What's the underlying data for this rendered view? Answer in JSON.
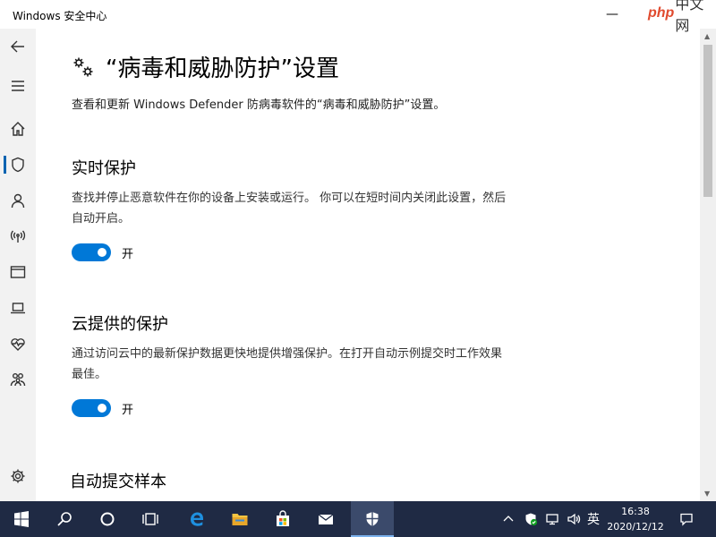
{
  "window": {
    "title": "Windows 安全中心",
    "minimize_glyph": "—",
    "maximize_glyph": "☐"
  },
  "watermark": {
    "php": "php",
    "cn": "中文网"
  },
  "sidebar": {
    "items": [
      {
        "name": "back",
        "icon": "back-arrow-icon"
      },
      {
        "name": "menu",
        "icon": "hamburger-icon"
      },
      {
        "name": "home",
        "icon": "home-icon"
      },
      {
        "name": "virus-protection",
        "icon": "shield-icon",
        "active": true
      },
      {
        "name": "account",
        "icon": "person-icon"
      },
      {
        "name": "firewall",
        "icon": "wireless-icon"
      },
      {
        "name": "app-browser",
        "icon": "browser-window-icon"
      },
      {
        "name": "device-security",
        "icon": "laptop-icon"
      },
      {
        "name": "device-health",
        "icon": "heart-pulse-icon"
      },
      {
        "name": "family",
        "icon": "family-icon"
      },
      {
        "name": "settings",
        "icon": "gear-icon"
      }
    ]
  },
  "page": {
    "title": "“病毒和威胁防护”设置",
    "description": "查看和更新 Windows Defender 防病毒软件的“病毒和威胁防护”设置。"
  },
  "sections": [
    {
      "heading": "实时保护",
      "text": "查找并停止恶意软件在你的设备上安装或运行。 你可以在短时间内关闭此设置，然后自动开启。",
      "toggle_label": "开"
    },
    {
      "heading": "云提供的保护",
      "text": "通过访问云中的最新保护数据更快地提供增强保护。在打开自动示例提交时工作效果最佳。",
      "toggle_label": "开"
    },
    {
      "heading": "自动提交样本"
    }
  ],
  "taskbar": {
    "apps": [
      "start-icon",
      "search-icon",
      "cortana-icon",
      "task-view-icon",
      "edge-icon",
      "file-explorer-icon",
      "store-icon",
      "mail-icon",
      "windows-security-icon"
    ],
    "tray": {
      "ime": "英",
      "time": "16:38",
      "date": "2020/12/12"
    }
  }
}
